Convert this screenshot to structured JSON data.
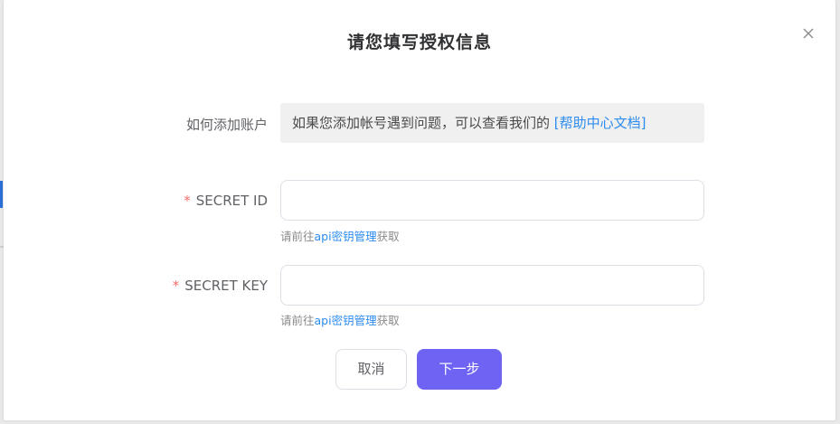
{
  "dialog": {
    "title": "请您填写授权信息",
    "close_icon": "close-icon"
  },
  "how_to_add": {
    "label": "如何添加账户",
    "text": "如果您添加帐号遇到问题，可以查看我们的 ",
    "link": "[帮助中心文档]"
  },
  "secret_id": {
    "required_mark": "*",
    "label": "SECRET ID",
    "value": "",
    "placeholder": "",
    "hint_prefix": "请前往",
    "hint_link": "api密钥管理",
    "hint_suffix": "获取"
  },
  "secret_key": {
    "required_mark": "*",
    "label": "SECRET KEY",
    "value": "",
    "placeholder": "",
    "hint_prefix": "请前往",
    "hint_link": "api密钥管理",
    "hint_suffix": "获取"
  },
  "buttons": {
    "cancel": "取消",
    "next": "下一步"
  },
  "colors": {
    "primary": "#6f63f4",
    "link": "#2d8cf0",
    "required": "#f56c6c"
  }
}
